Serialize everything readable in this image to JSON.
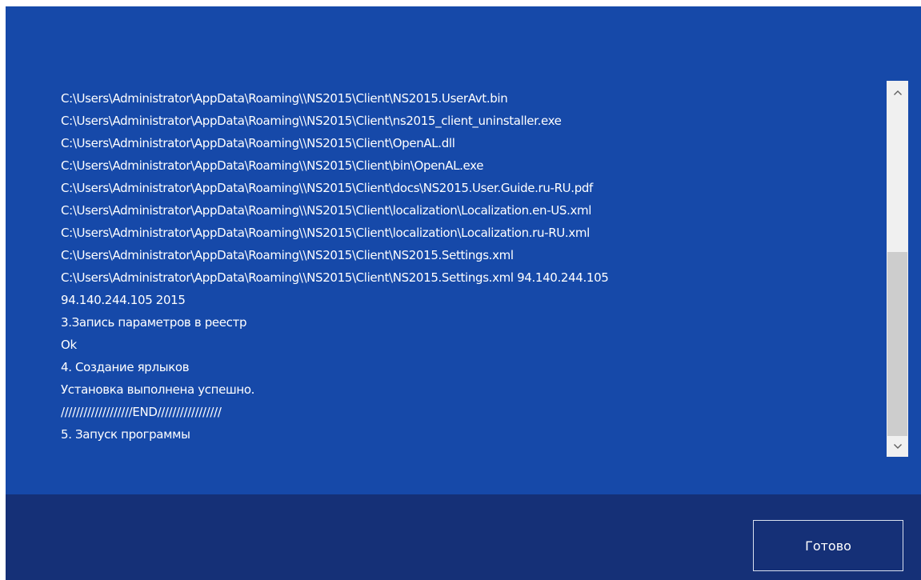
{
  "log": {
    "lines": [
      "C:\\Users\\Administrator\\AppData\\Roaming\\\\NS2015\\Client\\NS2015.UserAvt.bin",
      "C:\\Users\\Administrator\\AppData\\Roaming\\\\NS2015\\Client\\ns2015_client_uninstaller.exe",
      "C:\\Users\\Administrator\\AppData\\Roaming\\\\NS2015\\Client\\OpenAL.dll",
      "C:\\Users\\Administrator\\AppData\\Roaming\\\\NS2015\\Client\\bin\\OpenAL.exe",
      "C:\\Users\\Administrator\\AppData\\Roaming\\\\NS2015\\Client\\docs\\NS2015.User.Guide.ru-RU.pdf",
      "C:\\Users\\Administrator\\AppData\\Roaming\\\\NS2015\\Client\\localization\\Localization.en-US.xml",
      "C:\\Users\\Administrator\\AppData\\Roaming\\\\NS2015\\Client\\localization\\Localization.ru-RU.xml",
      "C:\\Users\\Administrator\\AppData\\Roaming\\\\NS2015\\Client\\NS2015.Settings.xml",
      "C:\\Users\\Administrator\\AppData\\Roaming\\\\NS2015\\Client\\NS2015.Settings.xml 94.140.244.105",
      "94.140.244.105 2015",
      "3.Запись параметров в реестр",
      "Ok",
      "4. Создание ярлыков",
      "Установка выполнена успешно.",
      "///////////////////END/////////////////",
      "5. Запуск программы"
    ],
    "scroll_position": 0.62
  },
  "icons": {
    "scroll_up": "chevron-up-icon",
    "scroll_down": "chevron-down-icon"
  },
  "footer": {
    "done_label": "Готово"
  },
  "colors": {
    "content_background": "#1649a9",
    "footer_background": "#153077",
    "text": "#ffffff",
    "scrollbar_track": "#f0f0f0",
    "scrollbar_thumb": "#cdcdcd"
  }
}
